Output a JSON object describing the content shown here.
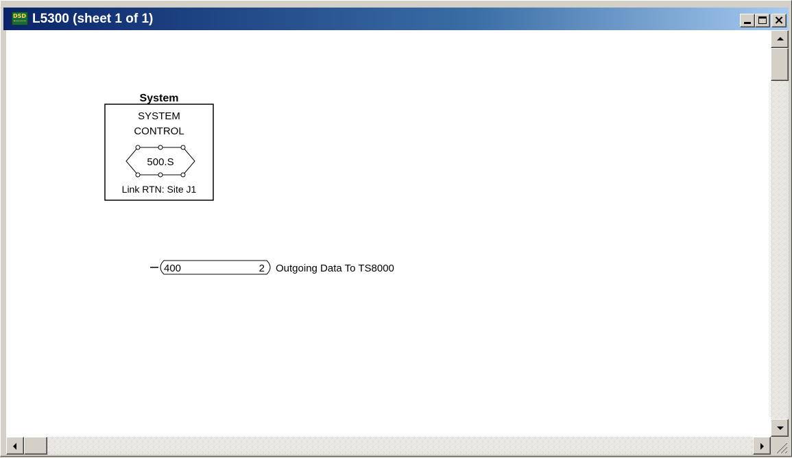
{
  "window": {
    "title": "L5300 (sheet 1 of 1)",
    "app_icon": "dsd-app-icon",
    "app_icon_text": "DSD"
  },
  "controls": {
    "minimize": "minimize-icon",
    "maximize": "maximize-icon",
    "close_glyph": "×"
  },
  "diagram": {
    "system_block": {
      "heading": "System",
      "line1": "SYSTEM",
      "line2": "CONTROL",
      "link_id": "500.S",
      "footer": "Link RTN: Site J1"
    },
    "connector": {
      "id": "400",
      "pin": "2",
      "description": "Outgoing Data To TS8000"
    }
  },
  "colors": {
    "titlebar_start": "#0a246a",
    "titlebar_end": "#a6caf0",
    "canvas": "#ffffff",
    "chrome": "#d4d0c8"
  }
}
